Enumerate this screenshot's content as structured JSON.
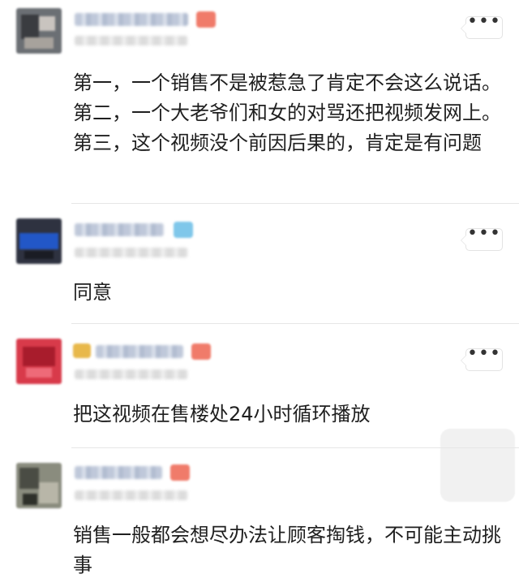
{
  "comments": [
    {
      "text": "第一，一个销售不是被惹急了肯定不会这么说话。第二，一个大老爷们和女的对骂还把视频发网上。第三，这个视频没个前因后果的，肯定是有问题",
      "more_label": "•••"
    },
    {
      "text": "同意",
      "more_label": "•••"
    },
    {
      "text": "把这视频在售楼处24小时循环播放",
      "more_label": "•••"
    },
    {
      "text": "销售一般都会想尽办法让顾客掏钱，不可能主动挑事",
      "more_label": ""
    }
  ],
  "colors": {
    "text": "#1f1f1f",
    "divider": "#e6e6e6",
    "badge_red": "#f07b6a",
    "badge_blue": "#7fc7ea",
    "badge_gold": "#e8b84a"
  },
  "icons": {
    "more": "more-dots-icon",
    "badge": "level-badge-icon"
  }
}
